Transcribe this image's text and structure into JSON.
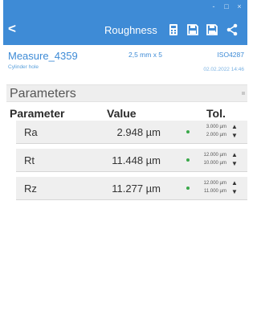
{
  "header": {
    "title": "Roughness",
    "back_symbol": "<",
    "window_controls": [
      "-",
      "□",
      "×"
    ],
    "icons": [
      "calculator-icon",
      "save-icon",
      "save-as-icon",
      "share-icon"
    ],
    "accent": "#3e8bd6"
  },
  "measure": {
    "name": "Measure_4359",
    "subtitle": "Cylinder hole",
    "length": "2,5 mm x 5",
    "standard": "ISO4287",
    "date": "02.02.2022  14:46"
  },
  "section": {
    "title": "Parameters"
  },
  "table": {
    "headers": {
      "parameter": "Parameter",
      "value": "Value",
      "tolerance": "Tol."
    },
    "rows": [
      {
        "parameter": "Ra",
        "value": "2.948 µm",
        "tol_upper": "3.000 µm",
        "tol_lower": "2.000 µm"
      },
      {
        "parameter": "Rt",
        "value": "11.448 µm",
        "tol_upper": "12.000 µm",
        "tol_lower": "10.000 µm"
      },
      {
        "parameter": "Rz",
        "value": "11.277 µm",
        "tol_upper": "12.000 µm",
        "tol_lower": "11.000 µm"
      }
    ],
    "status_color": "#3aa84a",
    "arrow_up": "▲",
    "arrow_down": "▼"
  }
}
